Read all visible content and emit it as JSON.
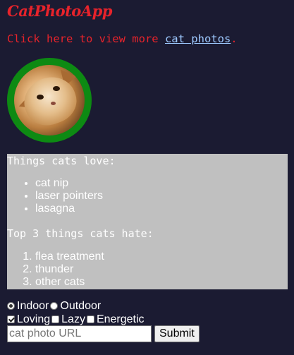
{
  "app": {
    "title": "CatPhotoApp"
  },
  "intro": {
    "prefix": "Click here to view more ",
    "link_text": "cat photos",
    "suffix": "."
  },
  "photo": {
    "alt": "A cute orange cat lying on its back."
  },
  "love_list": {
    "heading": "Things cats love:",
    "items": [
      "cat nip",
      "laser pointers",
      "lasagna"
    ]
  },
  "hate_list": {
    "heading": "Top 3 things cats hate:",
    "items": [
      "flea treatment",
      "thunder",
      "other cats"
    ]
  },
  "form": {
    "radios": [
      {
        "label": "Indoor",
        "checked": true
      },
      {
        "label": "Outdoor",
        "checked": false
      }
    ],
    "checkboxes": [
      {
        "label": "Loving",
        "checked": true
      },
      {
        "label": "Lazy",
        "checked": false
      },
      {
        "label": "Energetic",
        "checked": false
      }
    ],
    "url_input": {
      "placeholder": "cat photo URL",
      "value": ""
    },
    "submit_label": "Submit"
  },
  "colors": {
    "background": "#1b1b32",
    "title": "#e8232b",
    "link": "#9ec9ff",
    "photo_border": "#0d8a13",
    "list_panel": "#c0c0c0"
  }
}
